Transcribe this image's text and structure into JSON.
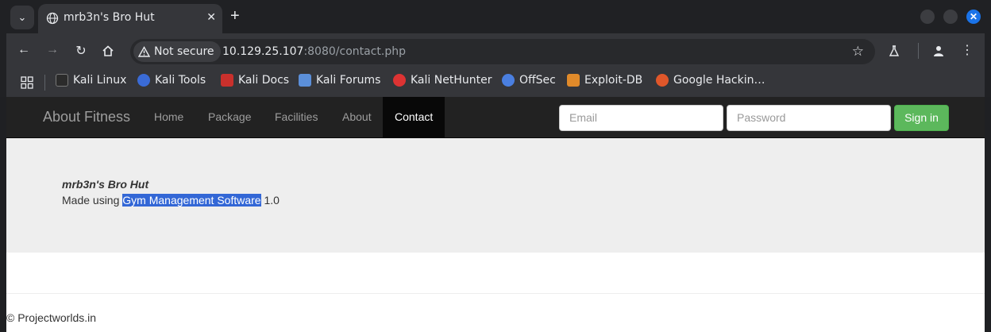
{
  "browser": {
    "tab_title": "mrb3n's Bro Hut",
    "security_label": "Not secure",
    "url_host": "10.129.25.107",
    "url_rest": ":8080/contact.php",
    "bookmarks": [
      "Kali Linux",
      "Kali Tools",
      "Kali Docs",
      "Kali Forums",
      "Kali NetHunter",
      "OffSec",
      "Exploit-DB",
      "Google Hackin…"
    ]
  },
  "navbar": {
    "brand": "About Fitness",
    "links": [
      "Home",
      "Package",
      "Facilities",
      "About",
      "Contact"
    ],
    "email_placeholder": "Email",
    "password_placeholder": "Password",
    "signin_label": "Sign in"
  },
  "content": {
    "site_name": "mrb3n's Bro Hut",
    "made_prefix": "Made using ",
    "software": "Gym Management Software",
    "version": " 1.0"
  },
  "footer": {
    "text": "© Projectworlds.in"
  }
}
